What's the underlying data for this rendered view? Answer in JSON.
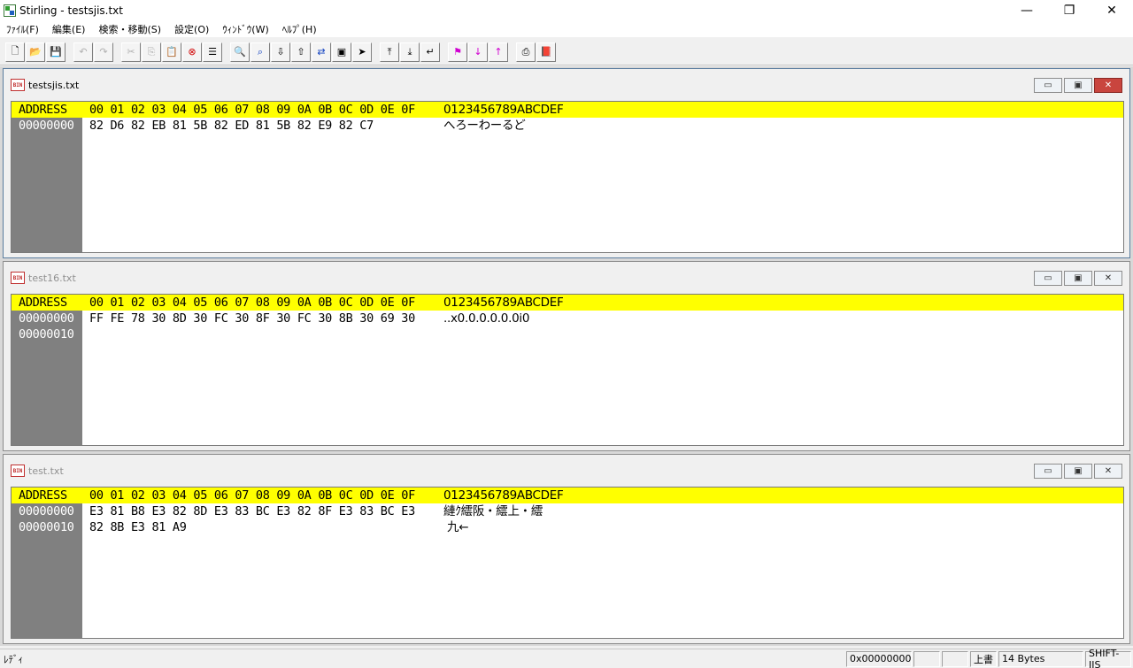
{
  "window": {
    "title": "Stirling - testsjis.txt",
    "minimize": "—",
    "restore": "❐",
    "close": "✕"
  },
  "menu": [
    "ﾌｧｲﾙ(F)",
    "編集(E)",
    "検索・移動(S)",
    "設定(O)",
    "ｳｨﾝﾄﾞｳ(W)",
    "ﾍﾙﾌﾟ(H)"
  ],
  "icons": {
    "doc_badge": "BIN"
  },
  "hex_header": {
    "address": "ADDRESS",
    "columns": "00 01 02 03 04 05 06 07 08 09 0A 0B 0C 0D 0E 0F",
    "text": "0123456789ABCDEF"
  },
  "documents": [
    {
      "title": "testsjis.txt",
      "rows": [
        {
          "addr": "00000000",
          "hex": "82 D6 82 EB 81 5B 82 ED 81 5B 82 E9 82 C7",
          "text": "へろーわーるど"
        }
      ]
    },
    {
      "title": "test16.txt",
      "rows": [
        {
          "addr": "00000000",
          "hex": "FF FE 78 30 8D 30 FC 30 8F 30 FC 30 8B 30 69 30",
          "text": "..x0.0.0.0.0.0i0"
        },
        {
          "addr": "00000010",
          "hex": "",
          "text": ""
        }
      ]
    },
    {
      "title": "test.txt",
      "rows": [
        {
          "addr": "00000000",
          "hex": "E3 81 B8 E3 82 8D E3 83 BC E3 82 8F E3 83 BC E3",
          "text": "縺ｸ繧阪・繧上・繧"
        },
        {
          "addr": "00000010",
          "hex": "82 8B E3 81 A9",
          "text": " 九←"
        }
      ]
    }
  ],
  "status": {
    "left": "ﾚﾃﾞｨ",
    "address": "0x00000000",
    "pane2": "",
    "pane3": "",
    "mode": "上書",
    "size": "14 Bytes",
    "encoding": "SHIFT-JIS"
  }
}
